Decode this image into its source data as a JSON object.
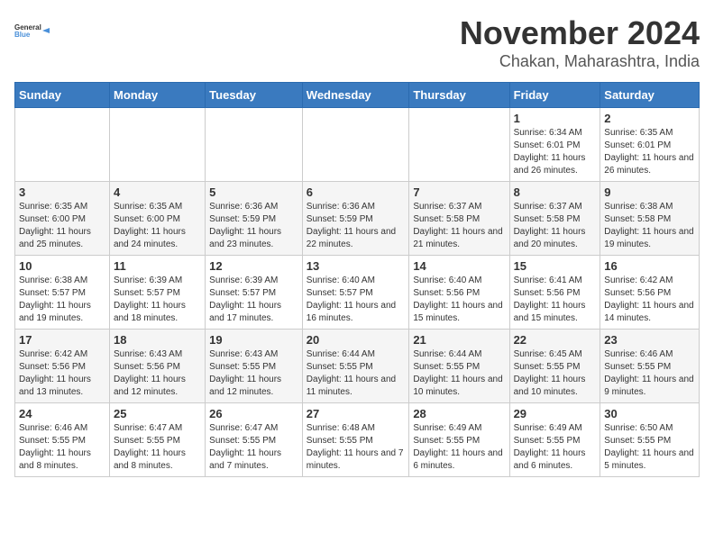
{
  "header": {
    "logo_general": "General",
    "logo_blue": "Blue",
    "month": "November 2024",
    "location": "Chakan, Maharashtra, India"
  },
  "weekdays": [
    "Sunday",
    "Monday",
    "Tuesday",
    "Wednesday",
    "Thursday",
    "Friday",
    "Saturday"
  ],
  "weeks": [
    [
      {
        "day": "",
        "info": ""
      },
      {
        "day": "",
        "info": ""
      },
      {
        "day": "",
        "info": ""
      },
      {
        "day": "",
        "info": ""
      },
      {
        "day": "",
        "info": ""
      },
      {
        "day": "1",
        "info": "Sunrise: 6:34 AM\nSunset: 6:01 PM\nDaylight: 11 hours and 26 minutes."
      },
      {
        "day": "2",
        "info": "Sunrise: 6:35 AM\nSunset: 6:01 PM\nDaylight: 11 hours and 26 minutes."
      }
    ],
    [
      {
        "day": "3",
        "info": "Sunrise: 6:35 AM\nSunset: 6:00 PM\nDaylight: 11 hours and 25 minutes."
      },
      {
        "day": "4",
        "info": "Sunrise: 6:35 AM\nSunset: 6:00 PM\nDaylight: 11 hours and 24 minutes."
      },
      {
        "day": "5",
        "info": "Sunrise: 6:36 AM\nSunset: 5:59 PM\nDaylight: 11 hours and 23 minutes."
      },
      {
        "day": "6",
        "info": "Sunrise: 6:36 AM\nSunset: 5:59 PM\nDaylight: 11 hours and 22 minutes."
      },
      {
        "day": "7",
        "info": "Sunrise: 6:37 AM\nSunset: 5:58 PM\nDaylight: 11 hours and 21 minutes."
      },
      {
        "day": "8",
        "info": "Sunrise: 6:37 AM\nSunset: 5:58 PM\nDaylight: 11 hours and 20 minutes."
      },
      {
        "day": "9",
        "info": "Sunrise: 6:38 AM\nSunset: 5:58 PM\nDaylight: 11 hours and 19 minutes."
      }
    ],
    [
      {
        "day": "10",
        "info": "Sunrise: 6:38 AM\nSunset: 5:57 PM\nDaylight: 11 hours and 19 minutes."
      },
      {
        "day": "11",
        "info": "Sunrise: 6:39 AM\nSunset: 5:57 PM\nDaylight: 11 hours and 18 minutes."
      },
      {
        "day": "12",
        "info": "Sunrise: 6:39 AM\nSunset: 5:57 PM\nDaylight: 11 hours and 17 minutes."
      },
      {
        "day": "13",
        "info": "Sunrise: 6:40 AM\nSunset: 5:57 PM\nDaylight: 11 hours and 16 minutes."
      },
      {
        "day": "14",
        "info": "Sunrise: 6:40 AM\nSunset: 5:56 PM\nDaylight: 11 hours and 15 minutes."
      },
      {
        "day": "15",
        "info": "Sunrise: 6:41 AM\nSunset: 5:56 PM\nDaylight: 11 hours and 15 minutes."
      },
      {
        "day": "16",
        "info": "Sunrise: 6:42 AM\nSunset: 5:56 PM\nDaylight: 11 hours and 14 minutes."
      }
    ],
    [
      {
        "day": "17",
        "info": "Sunrise: 6:42 AM\nSunset: 5:56 PM\nDaylight: 11 hours and 13 minutes."
      },
      {
        "day": "18",
        "info": "Sunrise: 6:43 AM\nSunset: 5:56 PM\nDaylight: 11 hours and 12 minutes."
      },
      {
        "day": "19",
        "info": "Sunrise: 6:43 AM\nSunset: 5:55 PM\nDaylight: 11 hours and 12 minutes."
      },
      {
        "day": "20",
        "info": "Sunrise: 6:44 AM\nSunset: 5:55 PM\nDaylight: 11 hours and 11 minutes."
      },
      {
        "day": "21",
        "info": "Sunrise: 6:44 AM\nSunset: 5:55 PM\nDaylight: 11 hours and 10 minutes."
      },
      {
        "day": "22",
        "info": "Sunrise: 6:45 AM\nSunset: 5:55 PM\nDaylight: 11 hours and 10 minutes."
      },
      {
        "day": "23",
        "info": "Sunrise: 6:46 AM\nSunset: 5:55 PM\nDaylight: 11 hours and 9 minutes."
      }
    ],
    [
      {
        "day": "24",
        "info": "Sunrise: 6:46 AM\nSunset: 5:55 PM\nDaylight: 11 hours and 8 minutes."
      },
      {
        "day": "25",
        "info": "Sunrise: 6:47 AM\nSunset: 5:55 PM\nDaylight: 11 hours and 8 minutes."
      },
      {
        "day": "26",
        "info": "Sunrise: 6:47 AM\nSunset: 5:55 PM\nDaylight: 11 hours and 7 minutes."
      },
      {
        "day": "27",
        "info": "Sunrise: 6:48 AM\nSunset: 5:55 PM\nDaylight: 11 hours and 7 minutes."
      },
      {
        "day": "28",
        "info": "Sunrise: 6:49 AM\nSunset: 5:55 PM\nDaylight: 11 hours and 6 minutes."
      },
      {
        "day": "29",
        "info": "Sunrise: 6:49 AM\nSunset: 5:55 PM\nDaylight: 11 hours and 6 minutes."
      },
      {
        "day": "30",
        "info": "Sunrise: 6:50 AM\nSunset: 5:55 PM\nDaylight: 11 hours and 5 minutes."
      }
    ]
  ]
}
